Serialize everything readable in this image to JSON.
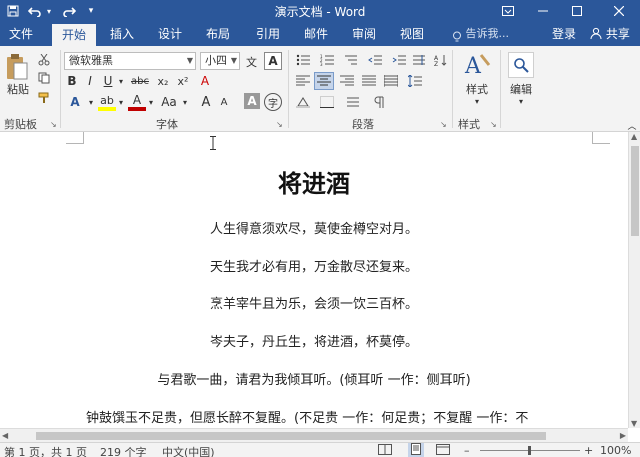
{
  "title_bar": {
    "title": "演示文档 - Word",
    "save_icon": "save-icon",
    "undo_icon": "undo-icon",
    "redo_icon": "redo-icon",
    "customize_icon": "customize-qat-icon",
    "ribbon_display_icon": "ribbon-display-icon",
    "minimize_icon": "minimize-icon",
    "maximize_icon": "maximize-icon",
    "close_icon": "close-icon"
  },
  "tabs": [
    {
      "label": "文件",
      "active": false
    },
    {
      "label": "开始",
      "active": true
    },
    {
      "label": "插入",
      "active": false
    },
    {
      "label": "设计",
      "active": false
    },
    {
      "label": "布局",
      "active": false
    },
    {
      "label": "引用",
      "active": false
    },
    {
      "label": "邮件",
      "active": false
    },
    {
      "label": "审阅",
      "active": false
    },
    {
      "label": "视图",
      "active": false
    }
  ],
  "tell_me": "告诉我...",
  "account": {
    "login": "登录",
    "share": "共享"
  },
  "ribbon": {
    "clipboard": {
      "label": "剪贴板",
      "paste_label": "粘贴"
    },
    "font": {
      "label": "字体",
      "font_name": "微软雅黑",
      "font_size": "小四",
      "bold": "B",
      "italic": "I",
      "underline": "U",
      "strikethrough": "abc",
      "subscript": "x₂",
      "superscript": "x²",
      "clear_format": "A",
      "text_effects": "A",
      "highlight": "ab",
      "font_color": "A",
      "change_case": "Aa",
      "grow_font": "A",
      "shrink_font": "A",
      "char_shading": "A",
      "enclose": "字"
    },
    "paragraph": {
      "label": "段落"
    },
    "styles": {
      "label": "样式",
      "styles_button": "样式"
    },
    "editing": {
      "label": "编辑",
      "editing_button": "编辑"
    }
  },
  "document": {
    "title": "将进酒",
    "lines": [
      "人生得意须欢尽，莫使金樽空对月。",
      "天生我才必有用，万金散尽还复来。",
      "烹羊宰牛且为乐，会须一饮三百杯。",
      "岑夫子，丹丘生，将进酒，杯莫停。",
      "与君歌一曲，请君为我倾耳听。(倾耳听  一作：侧耳听)",
      "钟鼓馔玉不足贵，但愿长醉不复醒。(不足贵  一作：何足贵；不复醒  一作：不"
    ]
  },
  "status_bar": {
    "page": "第 1 页，共 1 页",
    "words": "219 个字",
    "language": "中文(中国)",
    "zoom": "100%"
  },
  "colors": {
    "accent": "#2b579a",
    "ribbon_bg": "#f3f3f3",
    "highlight_yellow": "#ffff00",
    "font_red": "#c00000"
  }
}
